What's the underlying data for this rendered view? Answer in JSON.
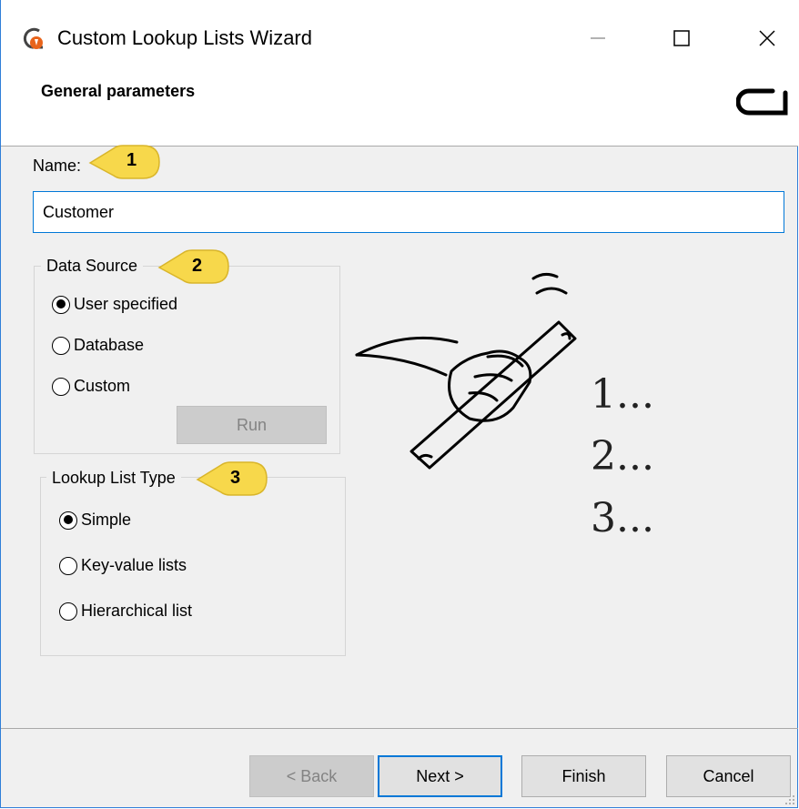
{
  "window": {
    "title": "Custom Lookup Lists Wizard",
    "controls": [
      "minimize-icon",
      "maximize-icon",
      "close-icon"
    ]
  },
  "header": {
    "title": "General parameters"
  },
  "name_section": {
    "label": "Name:",
    "value": "Customer",
    "callout": "1"
  },
  "data_source": {
    "legend": "Data Source",
    "callout": "2",
    "options": [
      {
        "label": "User specified",
        "checked": true
      },
      {
        "label": "Database",
        "checked": false
      },
      {
        "label": "Custom",
        "checked": false
      }
    ],
    "run_label": "Run"
  },
  "list_type": {
    "legend": "Lookup List Type",
    "callout": "3",
    "options": [
      {
        "label": "Simple",
        "checked": true
      },
      {
        "label": "Key-value lists",
        "checked": false
      },
      {
        "label": "Hierarchical list",
        "checked": false
      }
    ]
  },
  "illustration": {
    "steps": [
      "1...",
      "2...",
      "3..."
    ]
  },
  "footer": {
    "back_label": "< Back",
    "next_label": "Next >",
    "finish_label": "Finish",
    "cancel_label": "Cancel"
  },
  "colors": {
    "accent": "#0078d7",
    "callout": "#f7d84b",
    "disabled": "#cccccc"
  }
}
